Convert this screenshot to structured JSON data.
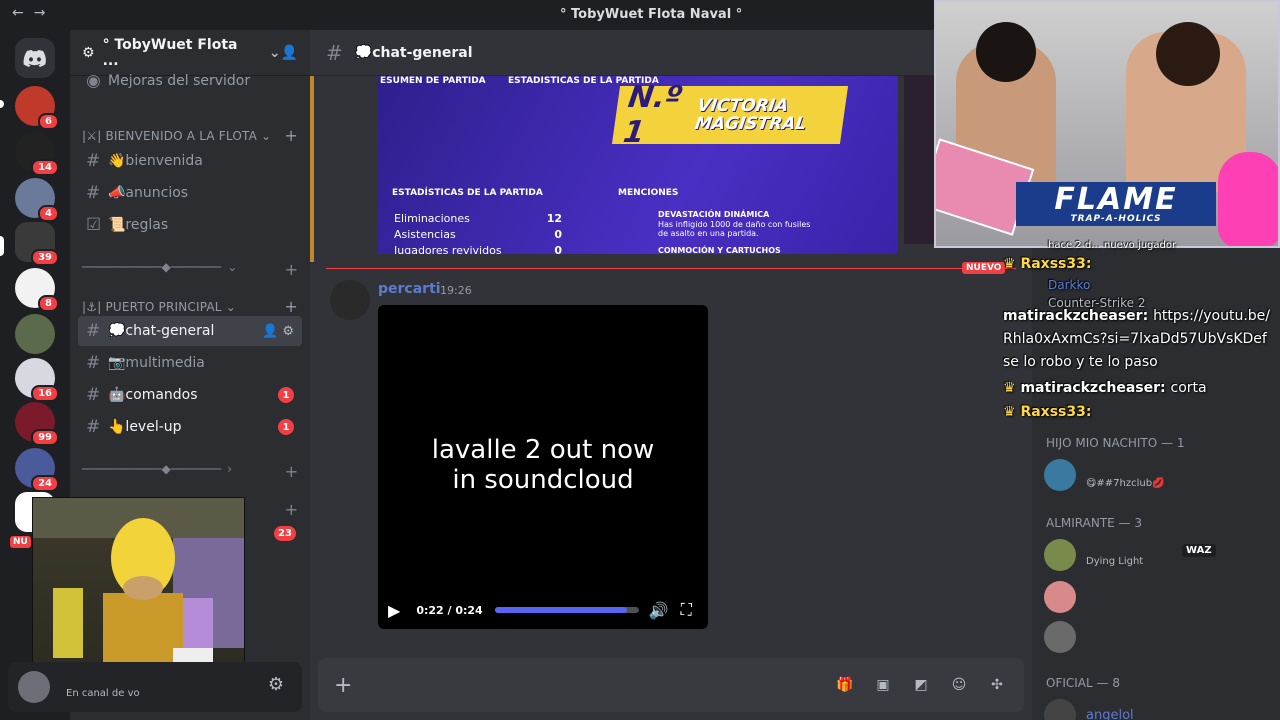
{
  "window": {
    "title": "° TobyWuet Flota Naval °",
    "back_icon": "←",
    "forward_icon": "→"
  },
  "rail": {
    "home_icon": "discord-logo-icon",
    "servers": [
      {
        "badge": "6"
      },
      {
        "badge": "14"
      },
      {
        "badge": "4"
      },
      {
        "badge": "39"
      },
      {
        "badge": "8"
      },
      {
        "badge": ""
      },
      {
        "badge": "16"
      },
      {
        "badge": "99"
      },
      {
        "badge": "24"
      },
      {
        "badge": ""
      }
    ],
    "nuevo": "NU"
  },
  "sidebar": {
    "guild_name": "° TobyWuet Flota ...",
    "items": {
      "boost": "Mejoras del servidor",
      "cat1": "|⚔| BIENVENIDO A LA FLOTA",
      "bienvenida": "👋bienvenida",
      "anuncios": "📣anuncios",
      "reglas": "📜reglas",
      "divider1": "───────────◆───────",
      "cat2": "|⚓| PUERTO PRINCIPAL",
      "chat_general": "💭chat-general",
      "multimedia": "📷multimedia",
      "comandos": "🤖comandos",
      "comandos_mentions": "1",
      "levelup": "👆level-up",
      "levelup_mentions": "1",
      "divider2": "───────────◆───────",
      "hidden_mentions": "23"
    }
  },
  "user_panel": {
    "status": "En canal de vo"
  },
  "chat": {
    "channel": "💭chat-general",
    "image": {
      "header_left": "ESUMEN DE PARTIDA",
      "header_right": "ESTADÍSTICAS DE LA PARTIDA",
      "rank": "N.º 1",
      "victory": "VICTORIA MAGISTRAL",
      "stats_title": "ESTADÍSTICAS DE LA PARTIDA",
      "stats": [
        {
          "label": "Eliminaciones",
          "value": "12"
        },
        {
          "label": "Asistencias",
          "value": "0"
        },
        {
          "label": "Jugadores revividos",
          "value": "0"
        }
      ],
      "mentions_title": "MENCIONES",
      "mention1_title": "DEVASTACIÓN DINÁMICA",
      "mention1_desc": "Has infligido 1000 de daño con fusiles de asalto en una partida.",
      "mention2_title": "CONMOCIÓN Y CARTUCHOS"
    },
    "new_tag": "NUEVO",
    "message": {
      "author": "percarti",
      "time": "19:26",
      "video_caption_line1": "lavalle 2 out now",
      "video_caption_line2": "in soundcloud",
      "video_time": "0:22 / 0:24",
      "progress": 0.917
    }
  },
  "members": {
    "group1": "HIJO MIO NACHITO — 1",
    "m1_activity": "😋##7hzclub💋",
    "group2": "ALMIRANTE — 3",
    "m2_tag": "WAZ",
    "m2_activity": "Dying Light",
    "group3": "OFICIAL — 8",
    "m3_name": "angelol",
    "darkko": "Darkko",
    "cs2": "Counter-Strike 2"
  },
  "stream_overlay": {
    "flame": "FLAME",
    "flame_sub": "TRAP-A-HOLICS",
    "jugador": "hace 2 d... nuevo jugador",
    "lines": [
      {
        "user": "Raxss33:",
        "text": ""
      },
      {
        "user": "matirackzcheaser:",
        "text": "https://youtu.be/"
      },
      {
        "user": "",
        "text": "Rhla0xAxmCs?si=7lxaDd57UbVsKDef"
      },
      {
        "user": "",
        "text": "se lo robo y te lo paso"
      },
      {
        "user": "matirackzcheaser:",
        "text": "corta"
      },
      {
        "user": "Raxss33:",
        "text": ""
      }
    ]
  }
}
